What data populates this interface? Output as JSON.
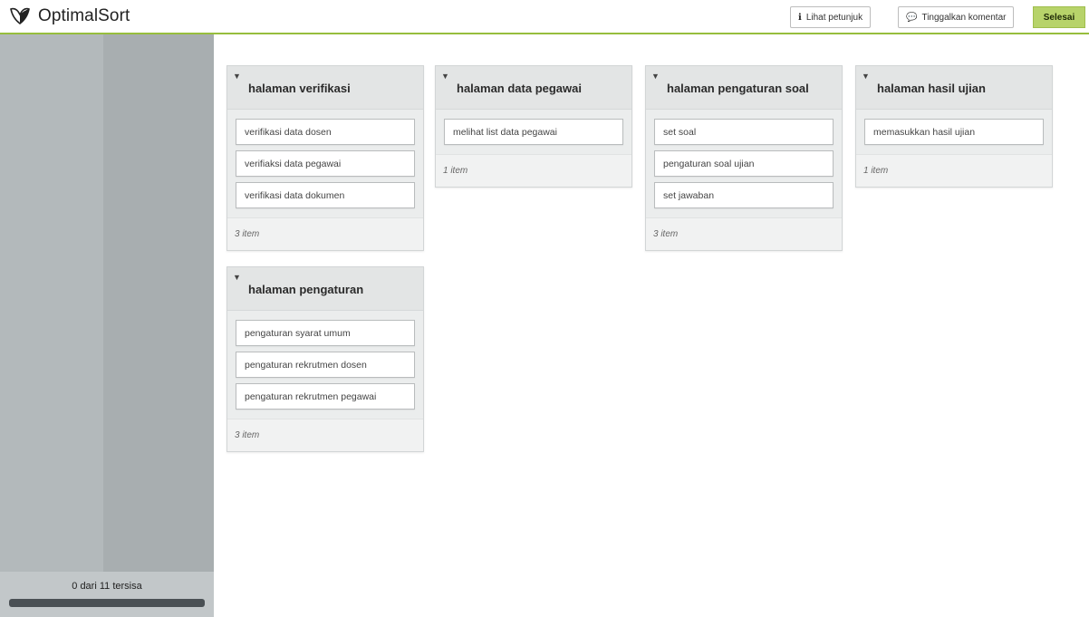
{
  "header": {
    "app_name": "OptimalSort",
    "hint_label": "Lihat petunjuk",
    "comment_label": "Tinggalkan komentar",
    "done_label": "Selesai"
  },
  "sidebar": {
    "remaining_text": "0 dari 11 tersisa",
    "progress": 0
  },
  "groups": [
    {
      "title": "halaman verifikasi",
      "items": [
        "verifikasi data dosen",
        "verifiaksi data pegawai",
        "verifikasi data dokumen"
      ],
      "count": "3 item"
    },
    {
      "title": "halaman pengaturan",
      "items": [
        "pengaturan syarat umum",
        "pengaturan rekrutmen dosen",
        "pengaturan rekrutmen pegawai"
      ],
      "count": "3 item"
    },
    {
      "title": "halaman data pegawai",
      "items": [
        "melihat list data pegawai"
      ],
      "count": "1 item"
    },
    {
      "title": "halaman pengaturan soal",
      "items": [
        "set soal",
        "pengaturan soal ujian",
        "set jawaban"
      ],
      "count": "3 item"
    },
    {
      "title": "halaman hasil ujian",
      "items": [
        "memasukkan hasil ujian"
      ],
      "count": "1 item"
    }
  ],
  "colors": {
    "accent_green": "#97be3d",
    "done_button": "#b7d36a",
    "sidebar": "#b3b9bb"
  }
}
